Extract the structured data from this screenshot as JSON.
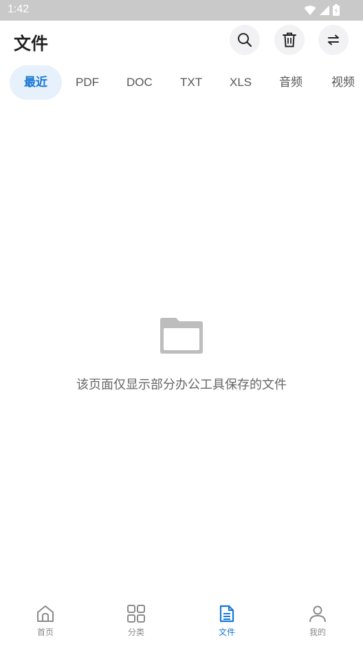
{
  "status_bar": {
    "time": "1:42"
  },
  "header": {
    "title": "文件"
  },
  "tabs": [
    {
      "label": "最近",
      "active": true
    },
    {
      "label": "PDF"
    },
    {
      "label": "DOC"
    },
    {
      "label": "TXT"
    },
    {
      "label": "XLS"
    },
    {
      "label": "音频"
    },
    {
      "label": "视频"
    }
  ],
  "empty_state": {
    "message": "该页面仅显示部分办公工具保存的文件"
  },
  "bottom_nav": [
    {
      "label": "首页",
      "icon": "home-icon"
    },
    {
      "label": "分类",
      "icon": "grid-icon"
    },
    {
      "label": "文件",
      "icon": "document-icon",
      "active": true
    },
    {
      "label": "我的",
      "icon": "user-icon"
    }
  ],
  "colors": {
    "accent": "#1677d4",
    "tab_active_bg": "#e6f1fc",
    "status_bar": "#c9c9c9"
  }
}
